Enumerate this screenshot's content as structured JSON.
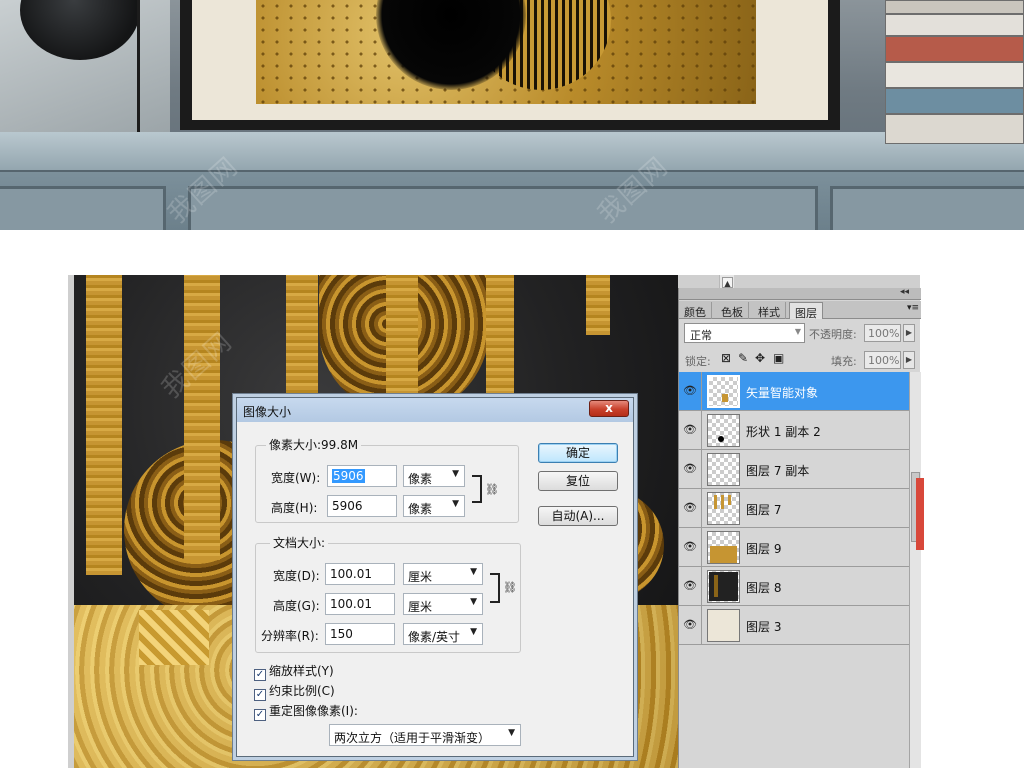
{
  "dialog": {
    "title": "图像大小",
    "close_label": "x",
    "pixel_dims": {
      "label": "像素大小:99.8M",
      "width_label": "宽度(W):",
      "width_value": "5906",
      "width_unit": "像素",
      "height_label": "高度(H):",
      "height_value": "5906",
      "height_unit": "像素"
    },
    "doc_size": {
      "label": "文档大小:",
      "width_label": "宽度(D):",
      "width_value": "100.01",
      "width_unit": "厘米",
      "height_label": "高度(G):",
      "height_value": "100.01",
      "height_unit": "厘米",
      "resolution_label": "分辨率(R):",
      "resolution_value": "150",
      "resolution_unit": "像素/英寸"
    },
    "buttons": {
      "ok": "确定",
      "reset": "复位",
      "auto": "自动(A)..."
    },
    "checkboxes": {
      "scale_styles": "缩放样式(Y)",
      "constrain": "约束比例(C)",
      "resample": "重定图像像素(I):"
    },
    "resample_method": "两次立方（适用于平滑渐变）"
  },
  "panel": {
    "tabs": [
      "颜色",
      "色板",
      "样式",
      "图层"
    ],
    "active_tab": "图层",
    "blend_mode": "正常",
    "opacity_label": "不透明度:",
    "opacity_value": "100%",
    "lock_label": "锁定:",
    "fill_label": "填充:",
    "fill_value": "100%",
    "layers": [
      {
        "name": "矢量智能对象",
        "selected": true
      },
      {
        "name": "形状 1 副本 2",
        "selected": false
      },
      {
        "name": "图层 7 副本",
        "selected": false
      },
      {
        "name": "图层 7",
        "selected": false
      },
      {
        "name": "图层 9",
        "selected": false
      },
      {
        "name": "图层 8",
        "selected": false
      },
      {
        "name": "图层 3",
        "selected": false
      }
    ]
  },
  "icons": {
    "eye": "eye-icon",
    "lock_transparent": "lock-transparent-icon",
    "lock_paint": "brush-icon",
    "lock_move": "move-icon",
    "lock_all": "lock-icon",
    "chain": "chain-link-icon",
    "panel_menu": "panel-menu-icon"
  },
  "colors": {
    "selected_layer": "#3c97ee",
    "dialog_title": "#b3c9e3",
    "close_button": "#c8402b",
    "gold": "#c69532"
  }
}
